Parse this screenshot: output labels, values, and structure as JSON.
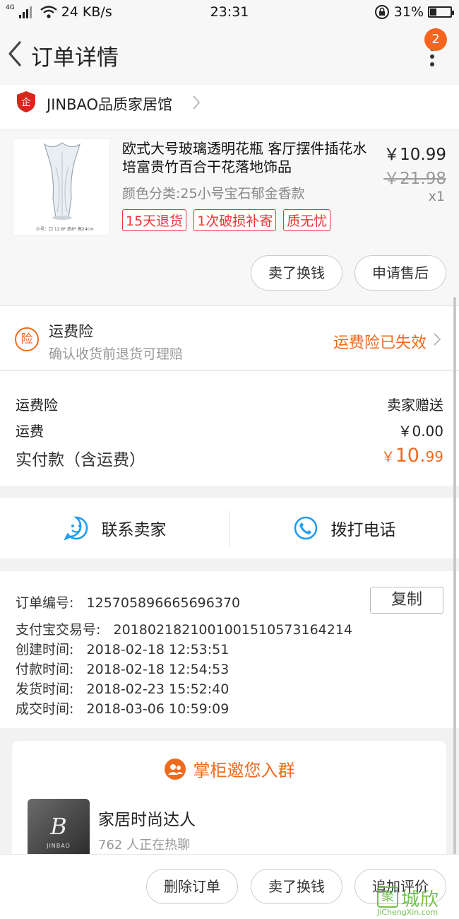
{
  "status_bar": {
    "network_type": "4G",
    "speed": "24 KB/s",
    "time": "23:31",
    "battery": "31%",
    "battery_level": 0.31
  },
  "header": {
    "title": "订单详情",
    "badge_count": "2"
  },
  "shop": {
    "name": "JINBAO品质家居馆"
  },
  "product": {
    "title": "欧式大号玻璃透明花瓶 客厅摆件插花水培富贵竹百合干花落地饰品",
    "sku": "颜色分类:25小号宝石郁金香款",
    "tags": [
      "15天退货",
      "1次破损补寄",
      "质无忧"
    ],
    "price": "￥10.99",
    "original_price": "￥21.98",
    "quantity": "x1",
    "thumb_caption": "小号：口 12.8* 底8* 高24cm",
    "sell_button": "卖了换钱",
    "after_sale_button": "申请售后"
  },
  "insurance": {
    "icon_text": "险",
    "title": "运费险",
    "description": "确认收货前退货可理赔",
    "status": "运费险已失效"
  },
  "fees": {
    "insurance_label": "运费险",
    "insurance_value": "卖家赠送",
    "shipping_label": "运费",
    "shipping_value": "￥0.00",
    "total_label": "实付款（含运费）",
    "total_currency": "￥",
    "total_integer": "10.",
    "total_decimal": "99"
  },
  "contact": {
    "seller_label": "联系卖家",
    "phone_label": "拨打电话"
  },
  "order_info": {
    "order_no_label": "订单编号:",
    "order_no": "125705896665696370",
    "copy_button": "复制",
    "alipay_label": "支付宝交易号:",
    "alipay_no": "2018021821001001510573164214",
    "created_label": "创建时间:",
    "created": "2018-02-18 12:53:51",
    "paid_label": "付款时间:",
    "paid": "2018-02-18 12:54:53",
    "shipped_label": "发货时间:",
    "shipped": "2018-02-23 15:52:40",
    "completed_label": "成交时间:",
    "completed": "2018-03-06 10:59:09"
  },
  "group": {
    "heading": "掌柜邀您入群",
    "name": "家居时尚达人",
    "count": "762 人正在热聊",
    "avatar_text": "B",
    "avatar_subtext": "JINBAO"
  },
  "bottom_bar": {
    "delete": "删除订单",
    "sell": "卖了换钱",
    "review": "追加评价"
  },
  "watermark": {
    "icon": "聚",
    "cn": "城欣",
    "en": "JiChengXin.com"
  },
  "colors": {
    "accent": "#f06a1e",
    "tag_red": "#e33333",
    "contact_blue": "#1f9cf0"
  }
}
